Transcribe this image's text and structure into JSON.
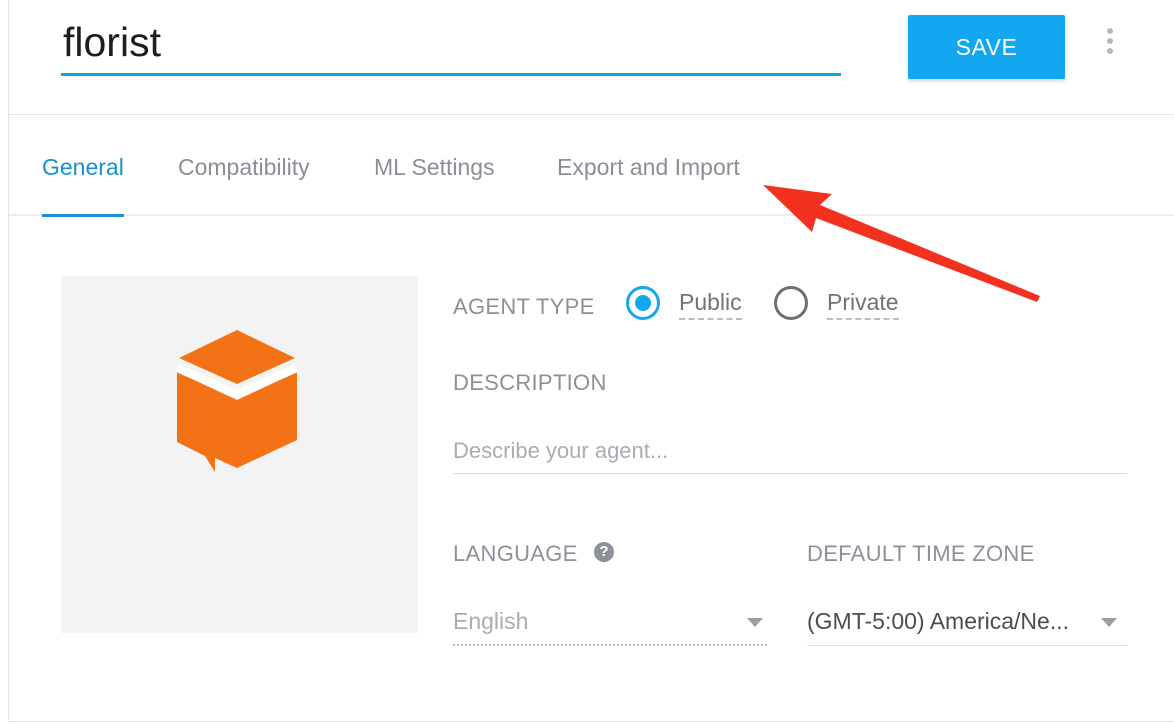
{
  "header": {
    "agent_name": "florist",
    "save_label": "SAVE"
  },
  "tabs": [
    {
      "label": "General",
      "active": true
    },
    {
      "label": "Compatibility",
      "active": false
    },
    {
      "label": "ML Settings",
      "active": false
    },
    {
      "label": "Export and Import",
      "active": false
    }
  ],
  "form": {
    "agent_type": {
      "label": "AGENT TYPE",
      "options": [
        "Public",
        "Private"
      ],
      "selected": "Public"
    },
    "description": {
      "label": "DESCRIPTION",
      "placeholder": "Describe your agent...",
      "value": ""
    },
    "language": {
      "label": "LANGUAGE",
      "value": "English"
    },
    "time_zone": {
      "label": "DEFAULT TIME ZONE",
      "value": "(GMT-5:00) America/Ne..."
    }
  },
  "icons": {
    "more": "more-vertical-icon",
    "help": "question-circle-icon",
    "logo": "agent-chat-box-icon",
    "annotation": "red-arrow-annotation"
  },
  "colors": {
    "accent": "#12a7f0",
    "tab_active": "#1a8fd1",
    "logo": "#f47216",
    "annotation": "#f2321e"
  }
}
